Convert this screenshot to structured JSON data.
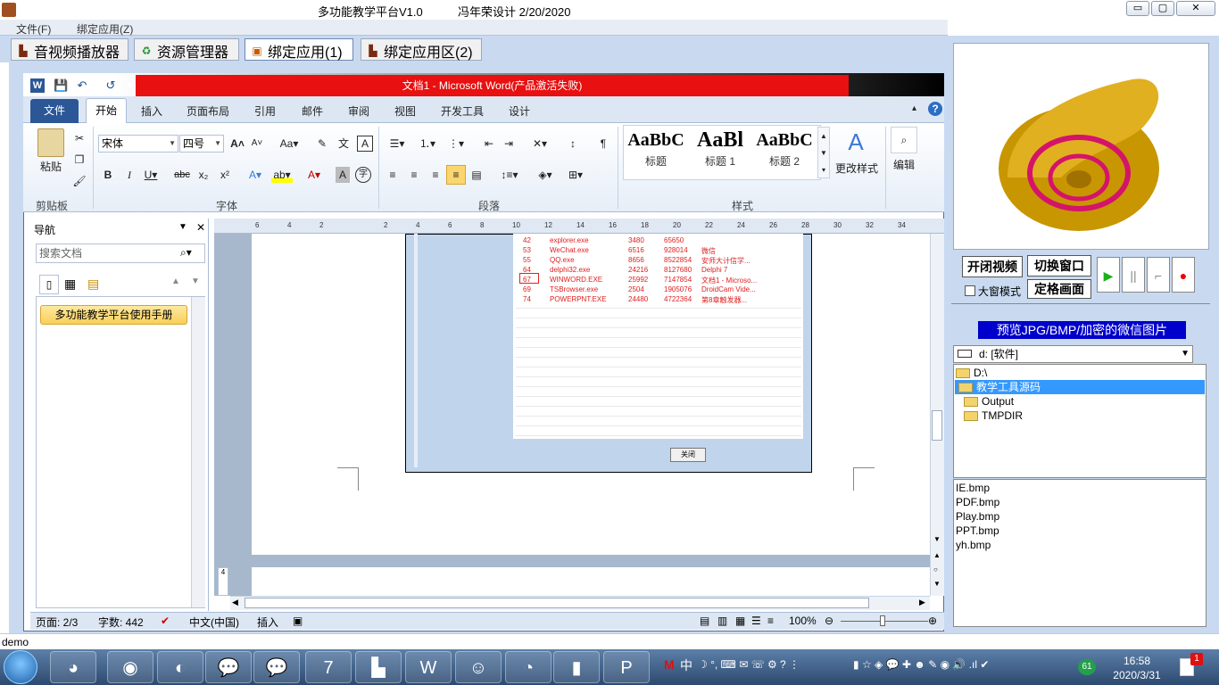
{
  "window": {
    "app_title": "多功能教学平台V1.0",
    "author": "冯年荣设计   2/20/2020",
    "min": "▭",
    "max": "▢",
    "close": "✕"
  },
  "menu": [
    "文件(F)",
    "绑定应用(Z)"
  ],
  "tabs": [
    {
      "label": "音视频播放器"
    },
    {
      "label": "资源管理器"
    },
    {
      "label": "绑定应用(1)"
    },
    {
      "label": "绑定应用区(2)"
    }
  ],
  "word": {
    "title": "文档1  -  Microsoft Word(产品激活失败)",
    "ribbon_tabs": [
      "文件",
      "开始",
      "插入",
      "页面布局",
      "引用",
      "邮件",
      "审阅",
      "视图",
      "开发工具",
      "设计"
    ],
    "groups": {
      "clipboard": "剪贴板",
      "font": "字体",
      "paragraph": "段落",
      "styles": "样式",
      "editing": "编辑"
    },
    "paste_label": "粘贴",
    "font_name": "宋体",
    "font_size": "四号",
    "styles": [
      {
        "sample": "AaBbC",
        "name": "标题"
      },
      {
        "sample": "AaBl",
        "name": "标题 1"
      },
      {
        "sample": "AaBbC",
        "name": "标题 2"
      }
    ],
    "change_styles": "更改样式",
    "editing_label": "编辑",
    "nav": {
      "title": "导航",
      "search_placeholder": "搜索文档",
      "heading": "多功能教学平台使用手册"
    },
    "process_rows": [
      {
        "id": "42",
        "name": "explorer.exe",
        "pid": "3480",
        "mem": "65650",
        "title": ""
      },
      {
        "id": "53",
        "name": "WeChat.exe",
        "pid": "6516",
        "mem": "928014",
        "title": "微信"
      },
      {
        "id": "55",
        "name": "QQ.exe",
        "pid": "8656",
        "mem": "8522854",
        "title": "安师大计信学..."
      },
      {
        "id": "64",
        "name": "delphi32.exe",
        "pid": "24216",
        "mem": "8127680",
        "title": "Delphi 7"
      },
      {
        "id": "67",
        "name": "WINWORD.EXE",
        "pid": "25992",
        "mem": "7147854",
        "title": "文档1 - Microso..."
      },
      {
        "id": "69",
        "name": "TSBrowser.exe",
        "pid": "2504",
        "mem": "1905076",
        "title": "DroidCam Vide..."
      },
      {
        "id": "74",
        "name": "POWERPNT.EXE",
        "pid": "24480",
        "mem": "4722364",
        "title": "第8章触发器..."
      }
    ],
    "close_btn": "关闭",
    "status": {
      "page": "页面: 2/3",
      "words": "字数: 442",
      "lang": "中文(中国)",
      "mode": "插入",
      "zoom": "100%"
    }
  },
  "right_panel": {
    "btn_close_video": "开闭视频",
    "btn_switch_window": "切换窗口",
    "btn_freeze": "定格画面",
    "big_window_label": "大窗模式",
    "preview_title": "预览JPG/BMP/加密的微信图片",
    "drive": "d: [软件]",
    "dirs": [
      "D:\\",
      "教学工具源码",
      "Output",
      "TMPDIR"
    ],
    "files": [
      "IE.bmp",
      "PDF.bmp",
      "Play.bmp",
      "PPT.bmp",
      "yh.bmp"
    ]
  },
  "status_text": "demo",
  "taskbar": {
    "time": "16:58",
    "date": "2020/3/31",
    "badge": "1",
    "tray_count": "61",
    "ime": "中"
  },
  "colors": {
    "accent": "#2b5797",
    "title_red": "#e81010",
    "preview_blue": "#0000cc",
    "panel_bg": "#c9daf0"
  }
}
